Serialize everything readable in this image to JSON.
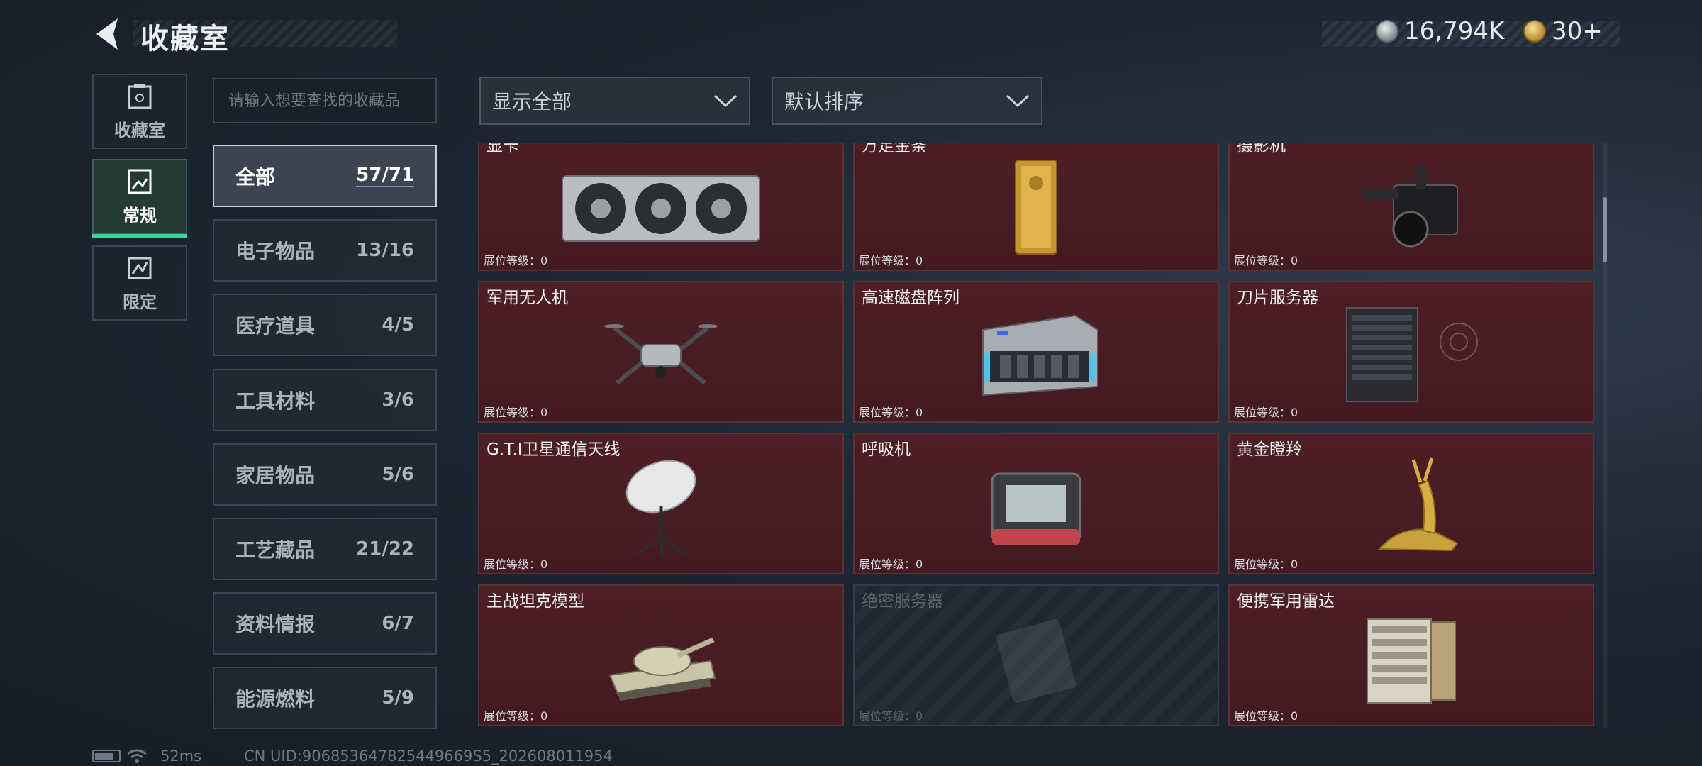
{
  "header": {
    "title": "收藏室",
    "currencies": [
      {
        "icon": "silver-coin-icon",
        "value": "16,794K"
      },
      {
        "icon": "gold-coin-icon",
        "value": "30+"
      }
    ]
  },
  "nav": [
    {
      "label": "收藏室",
      "icon": "collection-room-icon",
      "active": false
    },
    {
      "label": "常规",
      "icon": "regular-icon",
      "active": true
    },
    {
      "label": "限定",
      "icon": "limited-icon",
      "active": false
    }
  ],
  "search": {
    "placeholder": "请输入想要查找的收藏品"
  },
  "categories": [
    {
      "name": "全部",
      "count": "57/71",
      "active": true
    },
    {
      "name": "电子物品",
      "count": "13/16"
    },
    {
      "name": "医疗道具",
      "count": "4/5"
    },
    {
      "name": "工具材料",
      "count": "3/6"
    },
    {
      "name": "家居物品",
      "count": "5/6"
    },
    {
      "name": "工艺藏品",
      "count": "21/22"
    },
    {
      "name": "资料情报",
      "count": "6/7"
    },
    {
      "name": "能源燃料",
      "count": "5/9"
    }
  ],
  "filters": {
    "display": "显示全部",
    "sort": "默认排序"
  },
  "items": [
    {
      "name": "显卡",
      "level": "展位等级：0",
      "art": "graphics-card"
    },
    {
      "name": "万足金条",
      "level": "展位等级：0",
      "art": "gold-bar"
    },
    {
      "name": "摄影机",
      "level": "展位等级：0",
      "art": "camera"
    },
    {
      "name": "军用无人机",
      "level": "展位等级：0",
      "art": "drone"
    },
    {
      "name": "高速磁盘阵列",
      "level": "展位等级：0",
      "art": "disk-array"
    },
    {
      "name": "刀片服务器",
      "level": "展位等级：0",
      "art": "blade-server"
    },
    {
      "name": "G.T.I卫星通信天线",
      "level": "展位等级：0",
      "art": "satellite-dish"
    },
    {
      "name": "呼吸机",
      "level": "展位等级：0",
      "art": "ventilator"
    },
    {
      "name": "黄金瞪羚",
      "level": "展位等级：0",
      "art": "golden-gazelle"
    },
    {
      "name": "主战坦克模型",
      "level": "展位等级：0",
      "art": "tank-model"
    },
    {
      "name": "绝密服务器",
      "level": "展位等级：0",
      "art": "secret-server",
      "locked": true
    },
    {
      "name": "便携军用雷达",
      "level": "展位等级：0",
      "art": "portable-radar"
    }
  ],
  "footer": {
    "ping": "52ms",
    "uid": "CN UID:906853647825449669S5_202608011954"
  }
}
